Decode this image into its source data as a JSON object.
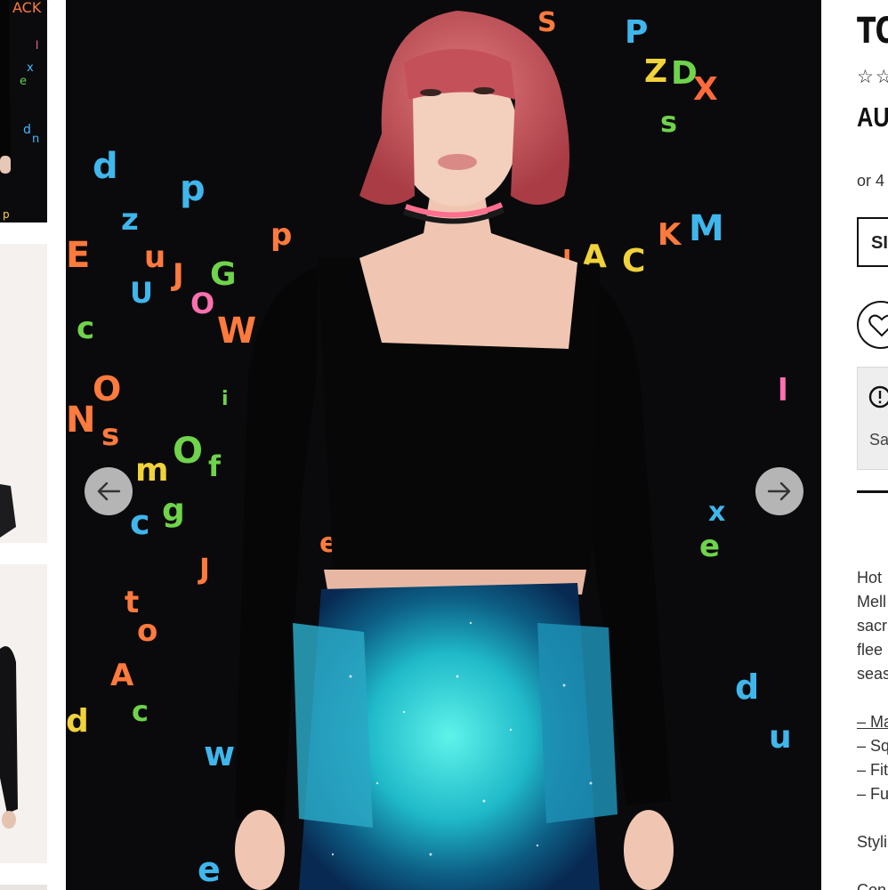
{
  "gallery": {
    "thumbnails": [
      {
        "label": "thumbnail-1"
      },
      {
        "label": "thumbnail-2"
      },
      {
        "label": "thumbnail-3"
      },
      {
        "label": "thumbnail-4"
      }
    ],
    "prev_icon": "arrow-left-icon",
    "next_icon": "arrow-right-icon"
  },
  "product": {
    "title": "TO",
    "stars": "☆☆",
    "price": "AU",
    "installment": "or 4",
    "size_label": "SI",
    "wishlist_icon": "heart-icon",
    "notice": {
      "icon": "alert-circle-icon",
      "text": "Sa"
    }
  },
  "description": {
    "lines": [
      "Hot",
      "Mell",
      "sacr",
      "flee",
      "seas"
    ],
    "features_heading": "– Ma",
    "features": [
      "– Sq",
      "– Fit",
      "– Fu"
    ],
    "styling": "Styli",
    "composition": "Con"
  },
  "colors": {
    "backdrop": "#0a0a0c",
    "arrow_bg": "#cdcdcd",
    "text_dark": "#111111",
    "notice_bg": "#eeeeee"
  }
}
